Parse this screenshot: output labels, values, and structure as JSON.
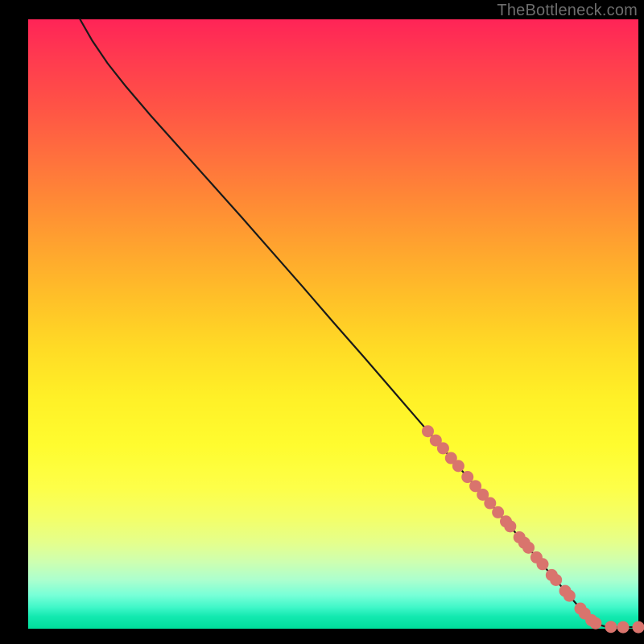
{
  "watermark": "TheBottleneck.com",
  "colors": {
    "background": "#000000",
    "curve_stroke": "#1a1a1a",
    "marker_fill": "#d9746d"
  },
  "chart_data": {
    "type": "line",
    "title": "",
    "xlabel": "",
    "ylabel": "",
    "xlim": [
      0,
      100
    ],
    "ylim": [
      0,
      100
    ],
    "curve": [
      {
        "x": 8.5,
        "y": 100
      },
      {
        "x": 10.5,
        "y": 96.5
      },
      {
        "x": 13.0,
        "y": 92.8
      },
      {
        "x": 16.0,
        "y": 89.0
      },
      {
        "x": 20.0,
        "y": 84.3
      },
      {
        "x": 25.0,
        "y": 78.7
      },
      {
        "x": 30.0,
        "y": 73.1
      },
      {
        "x": 35.0,
        "y": 67.5
      },
      {
        "x": 40.0,
        "y": 61.8
      },
      {
        "x": 45.0,
        "y": 56.1
      },
      {
        "x": 50.0,
        "y": 50.3
      },
      {
        "x": 55.0,
        "y": 44.6
      },
      {
        "x": 60.0,
        "y": 38.8
      },
      {
        "x": 65.0,
        "y": 33.0
      },
      {
        "x": 70.0,
        "y": 27.2
      },
      {
        "x": 75.0,
        "y": 21.4
      },
      {
        "x": 80.0,
        "y": 15.6
      },
      {
        "x": 85.0,
        "y": 9.7
      },
      {
        "x": 88.0,
        "y": 6.2
      },
      {
        "x": 90.5,
        "y": 3.3
      },
      {
        "x": 91.8,
        "y": 1.9
      },
      {
        "x": 92.6,
        "y": 1.2
      },
      {
        "x": 93.4,
        "y": 0.7
      },
      {
        "x": 94.6,
        "y": 0.35
      },
      {
        "x": 96.0,
        "y": 0.25
      },
      {
        "x": 98.0,
        "y": 0.25
      },
      {
        "x": 100.0,
        "y": 0.25
      }
    ],
    "markers": [
      {
        "x": 65.5,
        "y": 32.4
      },
      {
        "x": 66.8,
        "y": 30.9
      },
      {
        "x": 68.0,
        "y": 29.6
      },
      {
        "x": 69.3,
        "y": 28.0
      },
      {
        "x": 70.5,
        "y": 26.7
      },
      {
        "x": 72.0,
        "y": 24.9
      },
      {
        "x": 73.3,
        "y": 23.4
      },
      {
        "x": 74.5,
        "y": 22.0
      },
      {
        "x": 75.7,
        "y": 20.6
      },
      {
        "x": 77.0,
        "y": 19.1
      },
      {
        "x": 78.3,
        "y": 17.6
      },
      {
        "x": 79.0,
        "y": 16.8
      },
      {
        "x": 80.5,
        "y": 15.0
      },
      {
        "x": 81.3,
        "y": 14.1
      },
      {
        "x": 82.0,
        "y": 13.3
      },
      {
        "x": 83.3,
        "y": 11.7
      },
      {
        "x": 84.3,
        "y": 10.6
      },
      {
        "x": 85.8,
        "y": 8.8
      },
      {
        "x": 86.5,
        "y": 8.0
      },
      {
        "x": 88.0,
        "y": 6.2
      },
      {
        "x": 88.7,
        "y": 5.4
      },
      {
        "x": 90.5,
        "y": 3.3
      },
      {
        "x": 91.2,
        "y": 2.5
      },
      {
        "x": 92.3,
        "y": 1.4
      },
      {
        "x": 93.0,
        "y": 0.9
      },
      {
        "x": 95.5,
        "y": 0.3
      },
      {
        "x": 97.5,
        "y": 0.25
      },
      {
        "x": 100.0,
        "y": 0.25
      }
    ]
  }
}
